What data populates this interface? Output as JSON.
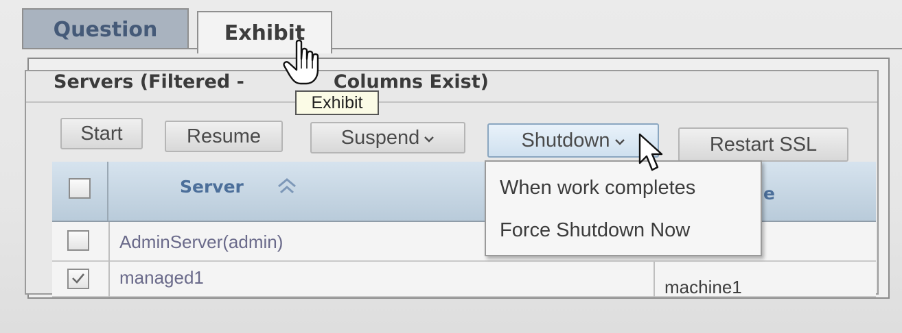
{
  "tabs": [
    {
      "label": "Question",
      "active": false
    },
    {
      "label": "Exhibit",
      "active": true
    }
  ],
  "panel": {
    "title_left": "Servers (Filtered -",
    "title_right": "Columns Exist)"
  },
  "toolbar": {
    "start_label": "Start",
    "resume_label": "Resume",
    "suspend_label": "Suspend",
    "shutdown_label": "Shutdown",
    "restart_ssl_label": "Restart SSL"
  },
  "table": {
    "columns": [
      "Server"
    ],
    "truncated_header_tail": "e",
    "rows": [
      {
        "server": "AdminServer(admin)",
        "machine": "",
        "checked": false
      },
      {
        "server": "managed1",
        "machine": "machine1",
        "checked": true
      }
    ]
  },
  "shutdown_menu": {
    "items": [
      "When work completes",
      "Force Shutdown Now"
    ]
  },
  "tooltip": {
    "text": "Exhibit"
  },
  "icons": {
    "dropdown": "chevron-down-icon",
    "sort": "sort-ascending-icon",
    "checkbox_checked": "checkmark-icon",
    "pointer_hand": "hand-cursor-icon",
    "pointer_arrow": "arrow-cursor-icon"
  },
  "colors": {
    "header_text": "#4c6f9a",
    "header_bg": "#c7d6e3",
    "tab_inactive_bg": "#a9b3bf",
    "tooltip_bg": "#fbfbe6"
  }
}
